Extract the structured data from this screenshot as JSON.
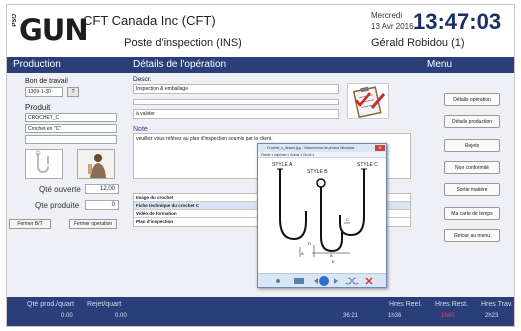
{
  "header": {
    "logo_prefix": "PSO",
    "logo_text": "GUN",
    "company": "CFT Canada Inc (CFT)",
    "station": "Poste d'inspection (INS)",
    "day": "Mercredi",
    "date": "13 Avr 2016",
    "clock": "13:47:03",
    "user": "Gérald Robidou (1)"
  },
  "band": {
    "production": "Production",
    "details": "Détails de l'opération",
    "menu": "Menu"
  },
  "left": {
    "work_order_label": "Bon de travail",
    "work_order_value": "1309-1-30",
    "help_button": "?",
    "product_label": "Produit",
    "product_code": "CROCHET_C",
    "product_desc": "Crochet en \"C\"",
    "qty_open_label": "Qté ouverte",
    "qty_open_value": "12.00",
    "qty_produced_label": "Qte produite",
    "qty_produced_value": "0",
    "close_wo_button": "Fermer B/T",
    "close_op_button": "Fermer operation"
  },
  "middle": {
    "descr_label": "Descr.",
    "descr_value": "Inspection & emballage",
    "status_value": "à valider",
    "note_label": "Note",
    "note_text": "veuillez vous référez au plan d'inspection soumis par le client.",
    "documents": [
      "Image du crochet",
      "Fiche technique du crochet C",
      "Vidéo de formation",
      "Plan d'inspection"
    ]
  },
  "viewer": {
    "title": "Crochet_c_dessin.jpg - Visionneuse de photos Windows",
    "menu": "Fichier ▾  Imprimer ▾  Graver ▾  Ouvrir ▾",
    "close": "✕",
    "style_a": "STYLE A",
    "style_b": "STYLE B",
    "style_c": "STYLE C",
    "dims": [
      "A",
      "B",
      "C",
      "D",
      "E"
    ]
  },
  "menu": {
    "items": [
      "Détails opération",
      "Détails production",
      "Rejets",
      "Non conformité",
      "Sortie matière",
      "Ma carte de temps",
      "Retour au menu"
    ]
  },
  "footer": {
    "qty_per_quart_label": "Qté prod./quart",
    "qty_per_quart_value": "0.00",
    "reject_label": "Rejet/quart",
    "reject_value": "0.00",
    "hidden_value_1": "36:21",
    "hidden_value_2": "1h36",
    "hours_real_label": "Hres Reel.",
    "hours_rest_label": "Hres Rest.",
    "hours_rest_value": "-1h40",
    "hours_work_label": "Hres Trav.",
    "hours_work_value": "2h23"
  },
  "colors": {
    "band": "#2a3f7a",
    "clock": "#1a2f68",
    "negative": "#ff3a3a"
  }
}
